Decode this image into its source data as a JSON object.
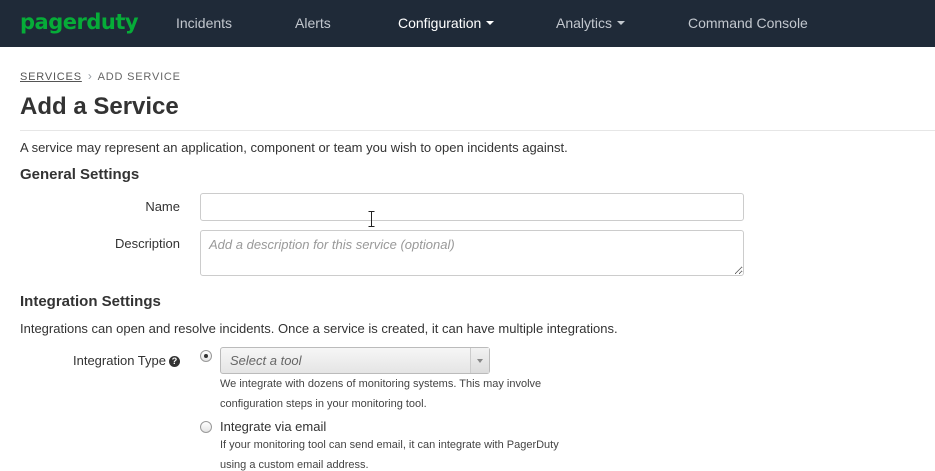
{
  "nav": {
    "logo": "pagerduty",
    "items": [
      {
        "label": "Incidents"
      },
      {
        "label": "Alerts"
      },
      {
        "label": "Configuration"
      },
      {
        "label": "Analytics"
      },
      {
        "label": "Command Console"
      }
    ]
  },
  "breadcrumb": {
    "parent": "SERVICES",
    "separator": "›",
    "current": "ADD SERVICE"
  },
  "page": {
    "title": "Add a Service",
    "intro": "A service may represent an application, component or team you wish to open incidents against."
  },
  "general_settings": {
    "heading": "General Settings",
    "name_label": "Name",
    "name_value": "",
    "description_label": "Description",
    "description_placeholder": "Add a description for this service (optional)"
  },
  "integration_settings": {
    "heading": "Integration Settings",
    "intro": "Integrations can open and resolve incidents. Once a service is created, it can have multiple integrations.",
    "type_label": "Integration Type",
    "help_icon": "question-circle-icon",
    "tool_select_placeholder": "Select a tool",
    "tool_help": "We integrate with dozens of monitoring systems. This may involve configuration steps in your monitoring tool.",
    "email_option_label": "Integrate via email",
    "email_help": "If your monitoring tool can send email, it can integrate with PagerDuty using a custom email address."
  },
  "colors": {
    "nav_bg": "#1f2a38",
    "brand_green": "#06ac38"
  }
}
